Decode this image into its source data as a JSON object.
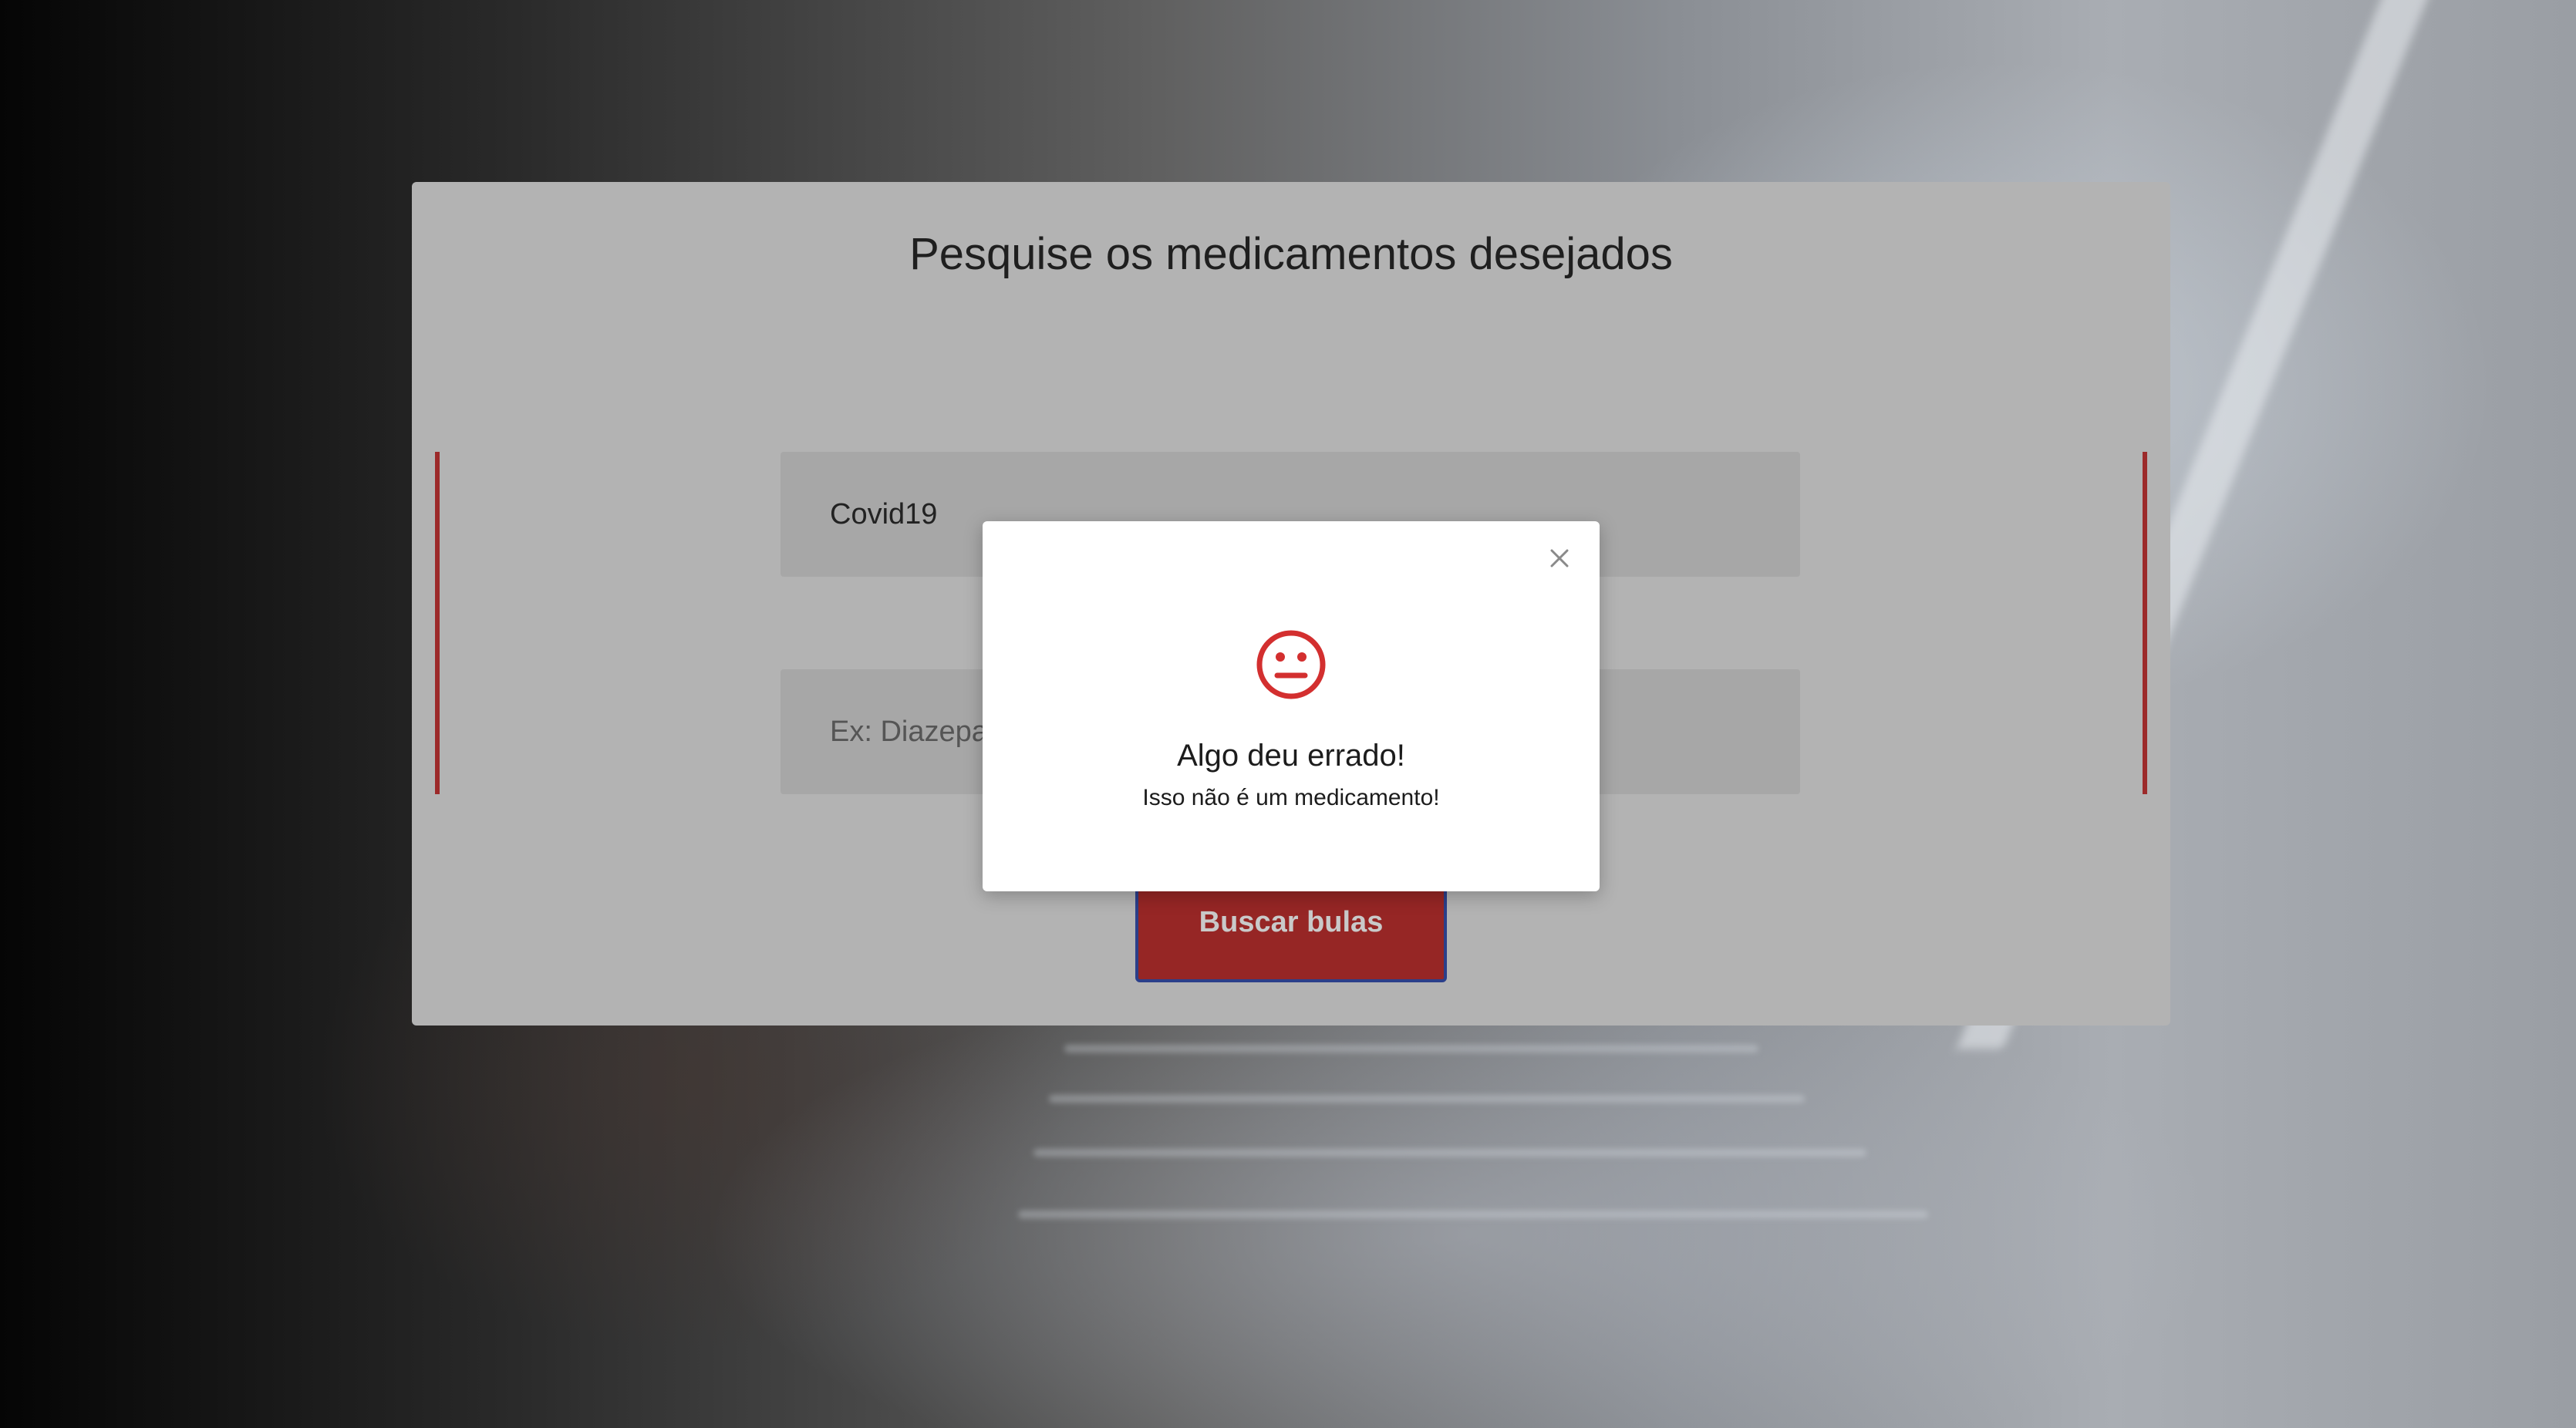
{
  "page": {
    "title": "Pesquise os medicamentos desejados"
  },
  "form": {
    "medication_value": "Covid19",
    "second_placeholder": "Ex: Diazepa",
    "search_button_label": "Buscar bulas"
  },
  "modal": {
    "title": "Algo deu errado!",
    "message": "Isso não é um medicamento!",
    "icon": "neutral-face-icon",
    "close_icon": "close-icon"
  },
  "colors": {
    "accent": "#962625",
    "panel_background": "#b3b3b3",
    "icon_red": "#d32f2f"
  }
}
